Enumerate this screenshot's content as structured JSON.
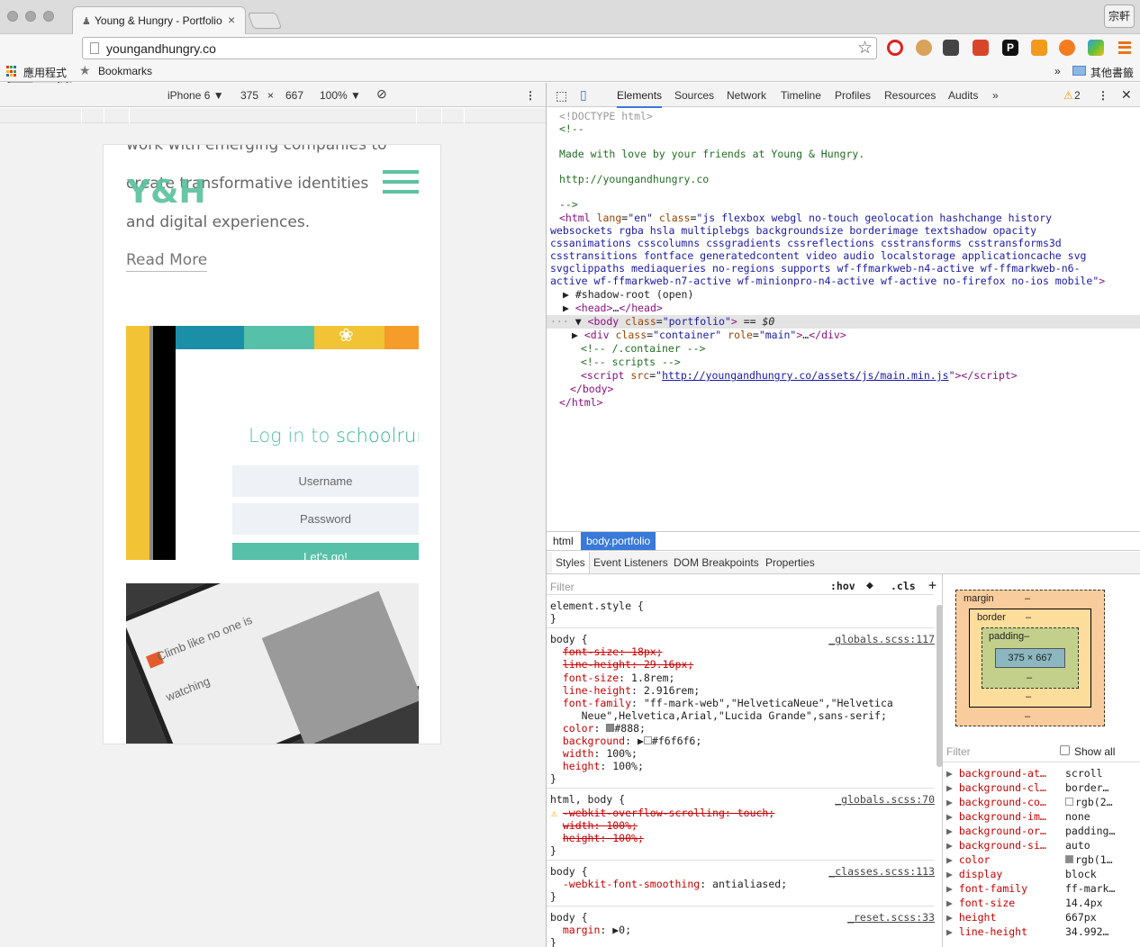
{
  "browser": {
    "tab_title": "Young & Hungry - Portfolio",
    "tab_close": "×",
    "profile_name": "宗軒",
    "url": "youngandhungry.co",
    "bookmarks_apps": "應用程式",
    "bookmarks_label": "Bookmarks",
    "bookmarks_more": "»",
    "other_bookmarks": "其他書籤"
  },
  "device_toolbar": {
    "device": "iPhone 6 ▼",
    "width": "375",
    "times": "×",
    "height": "667",
    "zoom": "100% ▼"
  },
  "page": {
    "text_line1": "work with emerging companies to",
    "text_line2": "create transformative identities",
    "text_line3": "and digital experiences.",
    "logo": "Y&H",
    "read_more": "Read More",
    "login_title": "Log in to ",
    "login_brand": "schoolrun",
    "username_placeholder": "Username",
    "password_placeholder": "Password",
    "login_button": "Let's go!",
    "tablet_heading_1": "Climb like no one is",
    "tablet_heading_2": "watching"
  },
  "devtools": {
    "tabs": [
      "Elements",
      "Sources",
      "Network",
      "Timeline",
      "Profiles",
      "Resources",
      "Audits"
    ],
    "more_tabs": "»",
    "warnings": "2",
    "elements_lines": [
      {
        "indent": 14,
        "html": "<span class='gr'>&lt;!DOCTYPE html&gt;</span>"
      },
      {
        "indent": 14,
        "html": "<span class='cm'>&lt;!--</span>"
      },
      {
        "indent": 14,
        "html": ""
      },
      {
        "indent": 14,
        "html": "<span class='cm'>Made with love by your friends at Young &amp; Hungry.</span>"
      },
      {
        "indent": 14,
        "html": ""
      },
      {
        "indent": 14,
        "html": "<span class='cm'>http://youngandhungry.co</span>"
      },
      {
        "indent": 14,
        "html": ""
      },
      {
        "indent": 14,
        "html": "<span class='cm'>--&gt;</span>"
      },
      {
        "indent": 14,
        "html": "<span class='tag'>&lt;html</span> <span class='an'>lang</span>=<span class='av'>\"en\"</span> <span class='an'>class</span>=<span class='av'>\"js flexbox webgl no-touch geolocation hashchange history</span>"
      },
      {
        "indent": 4,
        "html": "<span class='av'>websockets rgba hsla multiplebgs backgroundsize borderimage textshadow opacity</span>"
      },
      {
        "indent": 4,
        "html": "<span class='av'>cssanimations csscolumns cssgradients cssreflections csstransforms csstransforms3d</span>"
      },
      {
        "indent": 4,
        "html": "<span class='av'>csstransitions fontface generatedcontent video audio localstorage applicationcache svg</span>"
      },
      {
        "indent": 4,
        "html": "<span class='av'>svgclippaths mediaqueries no-regions supports wf-ffmarkweb-n4-active wf-ffmarkweb-n6-</span>"
      },
      {
        "indent": 4,
        "html": "<span class='av'>active wf-ffmarkweb-n7-active wf-minionpro-n4-active wf-active no-firefox no-ios mobile\"</span><span class='tag'>&gt;</span>"
      },
      {
        "indent": 18,
        "html": "▶ #shadow-root (open)"
      },
      {
        "indent": 18,
        "html": "▶ <span class='tag'>&lt;head&gt;</span>…<span class='tag'>&lt;/head&gt;</span>"
      },
      {
        "indent": 4,
        "html": "<span class='gr'>···</span> ▼ <span class='tag'>&lt;body</span> <span class='an'>class</span>=<span class='av'>\"portfolio\"</span><span class='tag'>&gt;</span> == <i>$0</i>",
        "selected": true
      },
      {
        "indent": 28,
        "html": "▶ <span class='tag'>&lt;div</span> <span class='an'>class</span>=<span class='av'>\"container\"</span> <span class='an'>role</span>=<span class='av'>\"main\"</span><span class='tag'>&gt;</span>…<span class='tag'>&lt;/div&gt;</span>"
      },
      {
        "indent": 38,
        "html": "<span class='cm'>&lt;!-- /.container --&gt;</span>"
      },
      {
        "indent": 38,
        "html": "<span class='cm'>&lt;!-- scripts --&gt;</span>"
      },
      {
        "indent": 38,
        "html": "<span class='tag'>&lt;script</span> <span class='an'>src</span>=<span class='av'>\"<u>http://youngandhungry.co/assets/js/main.min.js</u>\"</span><span class='tag'>&gt;&lt;/script&gt;</span>"
      },
      {
        "indent": 26,
        "html": "<span class='tag'>&lt;/body&gt;</span>"
      },
      {
        "indent": 14,
        "html": "<span class='tag'>&lt;/html&gt;</span>"
      }
    ],
    "breadcrumbs": [
      "html",
      "body.portfolio"
    ],
    "subtabs": [
      "Styles",
      "Event Listeners",
      "DOM Breakpoints",
      "Properties"
    ],
    "filter_placeholder": "Filter",
    "hov": ":hov",
    "cls": ".cls",
    "plus": "+",
    "style_lines": [
      {
        "html": "element.style {"
      },
      {
        "html": "}"
      },
      {
        "gap": true
      },
      {
        "html": "body {",
        "src": "_globals.scss:117"
      },
      {
        "html": "  <span class='strike'>font-size: 18px;</span>"
      },
      {
        "html": "  <span class='strike'>line-height: 29.16px;</span>"
      },
      {
        "html": "  <span class='prop'>font-size</span>: 1.8rem;"
      },
      {
        "html": "  <span class='prop'>line-height</span>: 2.916rem;"
      },
      {
        "html": "  <span class='prop'>font-family</span>: \"ff-mark-web\",\"HelveticaNeue\",\"Helvetica"
      },
      {
        "html": "     Neue\",Helvetica,Arial,\"Lucida Grande\",sans-serif;"
      },
      {
        "html": "  <span class='prop'>color</span>: <span style='display:inline-block;width:9px;height:9px;background:#888;border:1px solid #777'></span>#888;"
      },
      {
        "html": "  <span class='prop'>background</span>: ▶<span style='display:inline-block;width:9px;height:9px;background:#f6f6f6;border:1px solid #999'></span>#f6f6f6;"
      },
      {
        "html": "  <span class='prop'>width</span>: 100%;"
      },
      {
        "html": "  <span class='prop'>height</span>: 100%;"
      },
      {
        "html": "}"
      },
      {
        "gap": true
      },
      {
        "html": "html, body {",
        "src": "_globals.scss:70"
      },
      {
        "html": "  <span class='strike'>-webkit-overflow-scrolling: touch;</span>",
        "warn": true
      },
      {
        "html": "  <span class='strike'>width: 100%;</span>"
      },
      {
        "html": "  <span class='strike'>height: 100%;</span>"
      },
      {
        "html": "}"
      },
      {
        "gap": true
      },
      {
        "html": "body {",
        "src": "_classes.scss:113"
      },
      {
        "html": "  <span class='prop'>-webkit-font-smoothing</span>: antialiased;"
      },
      {
        "html": "}"
      },
      {
        "gap": true
      },
      {
        "html": "body {",
        "src": "_reset.scss:33"
      },
      {
        "html": "  <span class='prop'>margin</span>: ▶0;"
      },
      {
        "html": "}"
      }
    ],
    "box_model": {
      "margin_label": "margin",
      "border_label": "border",
      "padding_label": "padding–",
      "dash": "–",
      "content": "375 × 667"
    },
    "computed_filter": "Filter",
    "show_all": "Show all",
    "computed": [
      {
        "prop": "background-at…",
        "value": "scroll"
      },
      {
        "prop": "background-cl…",
        "value": "border…"
      },
      {
        "prop": "background-co…",
        "value": "rgb(2…",
        "swatch": "#ffffff"
      },
      {
        "prop": "background-im…",
        "value": "none"
      },
      {
        "prop": "background-or…",
        "value": "padding…"
      },
      {
        "prop": "background-si…",
        "value": "auto"
      },
      {
        "prop": "color",
        "value": "rgb(1…",
        "swatch": "#888888"
      },
      {
        "prop": "display",
        "value": "block"
      },
      {
        "prop": "font-family",
        "value": "ff-mark…"
      },
      {
        "prop": "font-size",
        "value": "14.4px"
      },
      {
        "prop": "height",
        "value": "667px"
      },
      {
        "prop": "line-height",
        "value": "34.992…"
      }
    ]
  },
  "colors": {
    "brand_green": "#5cc29f",
    "devtools_blue": "#3879d9"
  }
}
